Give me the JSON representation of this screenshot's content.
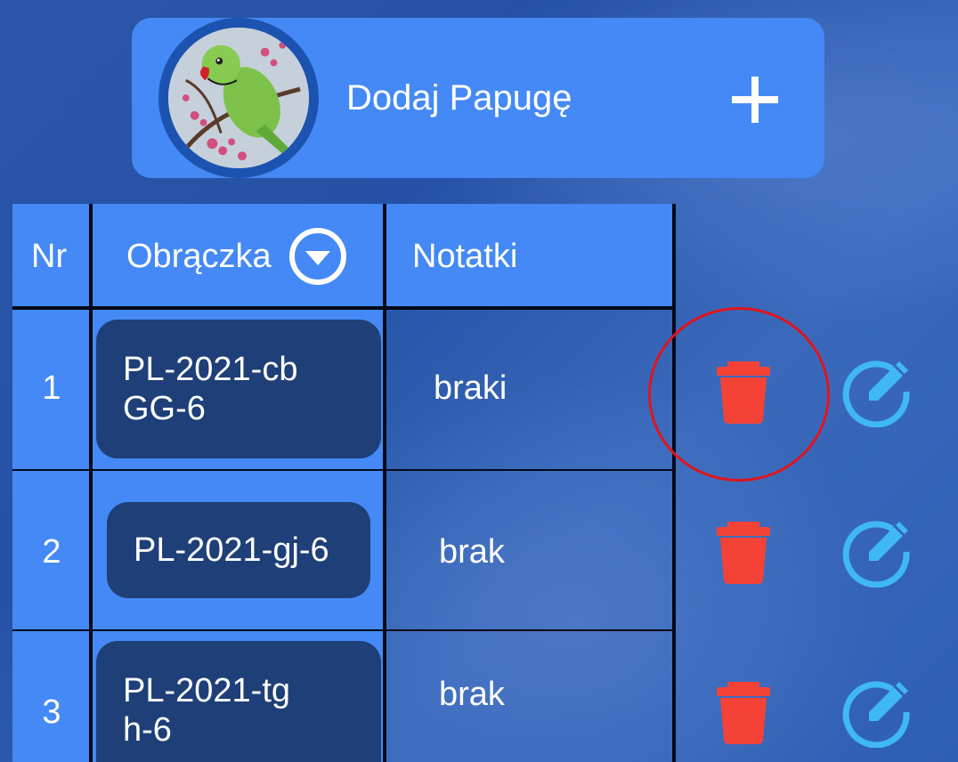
{
  "add_card": {
    "label": "Dodaj Papugę",
    "avatar_icon": "parrot-photo",
    "plus_icon": "plus-icon"
  },
  "table": {
    "headers": {
      "nr": "Nr",
      "ring": "Obrączka",
      "notes": "Notatki"
    },
    "sort_icon": "chevron-down-circle-icon",
    "rows": [
      {
        "nr": "1",
        "ring_line1": "PL-2021-cb",
        "ring_line2": "GG-6",
        "notes": "braki"
      },
      {
        "nr": "2",
        "ring_line1": "PL-2021-gj-6",
        "ring_line2": "",
        "notes": "brak"
      },
      {
        "nr": "3",
        "ring_line1": "PL-2021-tg",
        "ring_line2": "h-6",
        "notes": "brak"
      }
    ]
  },
  "colors": {
    "header_bg": "#4489f5",
    "chip_bg": "#1f3f78",
    "delete": "#f44336",
    "edit": "#40b8f5",
    "highlight": "#e0141e"
  }
}
